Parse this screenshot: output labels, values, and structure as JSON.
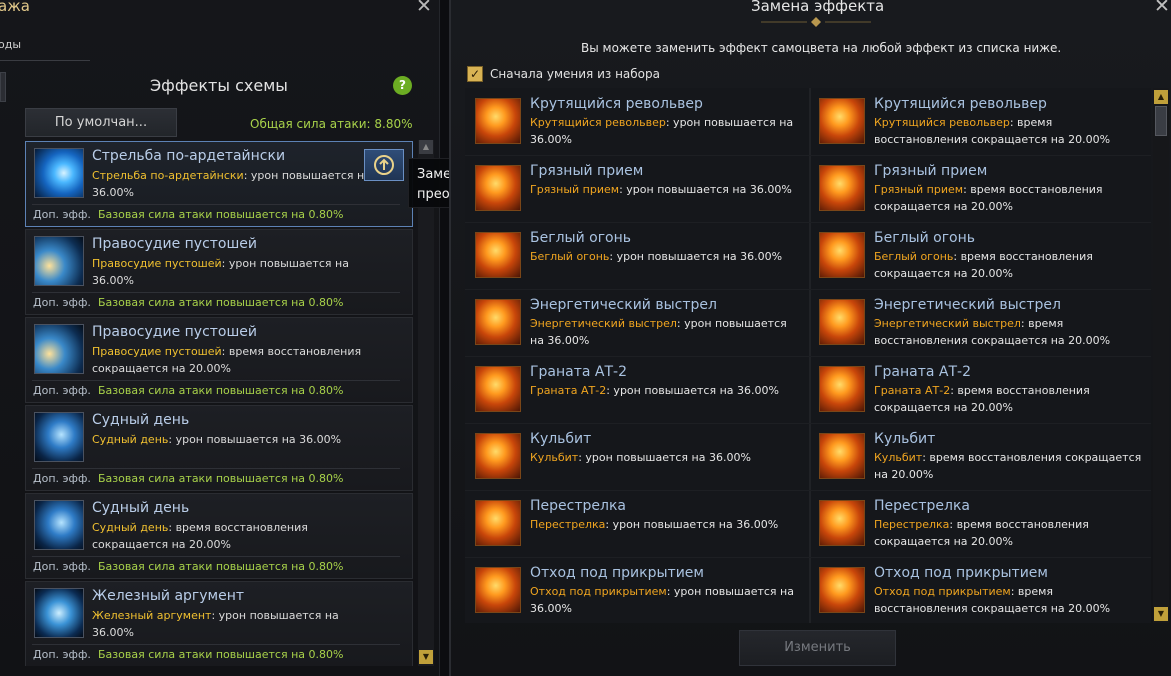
{
  "left_panel": {
    "title": "ажа",
    "tab": "оды",
    "scheme_title": "Эффекты схемы",
    "help_label": "?",
    "default_button": "По умолчан...",
    "total_attack": "Общая сила атаки: 8.80%",
    "effects": [
      {
        "name": "Стрельба по-ардетайнски",
        "skill": "Стрельба по-ардетайнски",
        "desc": ": урон повышается на 36.00%",
        "extra_label": "Доп. эфф.",
        "extra_value": "Базовая сила атаки повышается на 0.80%",
        "selected": true
      },
      {
        "name": "Правосудие пустошей",
        "skill": "Правосудие пустошей",
        "desc": ": урон повышается на 36.00%",
        "extra_label": "Доп. эфф.",
        "extra_value": "Базовая сила атаки повышается на 0.80%"
      },
      {
        "name": "Правосудие пустошей",
        "skill": "Правосудие пустошей",
        "desc": ": время восстановления сокращается на 20.00%",
        "extra_label": "Доп. эфф.",
        "extra_value": "Базовая сила атаки повышается на 0.80%"
      },
      {
        "name": "Судный день",
        "skill": "Судный день",
        "desc": ": урон повышается на 36.00%",
        "extra_label": "Доп. эфф.",
        "extra_value": "Базовая сила атаки повышается на 0.80%"
      },
      {
        "name": "Судный день",
        "skill": "Судный день",
        "desc": ": время восстановления сокращается на 20.00%",
        "extra_label": "Доп. эфф.",
        "extra_value": "Базовая сила атаки повышается на 0.80%"
      },
      {
        "name": "Железный аргумент",
        "skill": "Железный аргумент",
        "desc": ": урон повышается на 36.00%",
        "extra_label": "Доп. эфф.",
        "extra_value": "Базовая сила атаки повышается на 0.80%"
      }
    ]
  },
  "tooltip": "Замена эффекта преобразованного самоцвета",
  "right_panel": {
    "title": "Замена эффекта",
    "instruction": "Вы можете заменить эффект самоцвета на любой эффект из списка ниже.",
    "checkbox_label": "Сначала умения из набора",
    "checkbox_checked": true,
    "apply_button": "Изменить",
    "options": [
      {
        "name": "Крутящийся револьвер",
        "skill": "Крутящийся револьвер",
        "desc": ": урон повышается на 36.00%"
      },
      {
        "name": "Крутящийся револьвер",
        "skill": "Крутящийся револьвер",
        "desc": ": время восстановления сокращается на 20.00%"
      },
      {
        "name": "Грязный прием",
        "skill": "Грязный прием",
        "desc": ": урон повышается на 36.00%"
      },
      {
        "name": "Грязный прием",
        "skill": "Грязный прием",
        "desc": ": время восстановления сокращается на 20.00%"
      },
      {
        "name": "Беглый огонь",
        "skill": "Беглый огонь",
        "desc": ": урон повышается на 36.00%"
      },
      {
        "name": "Беглый огонь",
        "skill": "Беглый огонь",
        "desc": ": время восстановления сокращается на 20.00%"
      },
      {
        "name": "Энергетический выстрел",
        "skill": "Энергетический выстрел",
        "desc": ": урон повышается на 36.00%"
      },
      {
        "name": "Энергетический выстрел",
        "skill": "Энергетический выстрел",
        "desc": ": время восстановления сокращается на 20.00%"
      },
      {
        "name": "Граната АТ-2",
        "skill": "Граната АТ-2",
        "desc": ": урон повышается на 36.00%"
      },
      {
        "name": "Граната АТ-2",
        "skill": "Граната АТ-2",
        "desc": ": время восстановления сокращается на 20.00%"
      },
      {
        "name": "Кульбит",
        "skill": "Кульбит",
        "desc": ": урон повышается на 36.00%"
      },
      {
        "name": "Кульбит",
        "skill": "Кульбит",
        "desc": ": время восстановления сокращается на 20.00%"
      },
      {
        "name": "Перестрелка",
        "skill": "Перестрелка",
        "desc": ": урон повышается на 36.00%"
      },
      {
        "name": "Перестрелка",
        "skill": "Перестрелка",
        "desc": ": время восстановления сокращается на 20.00%"
      },
      {
        "name": "Отход под прикрытием",
        "skill": "Отход под прикрытием",
        "desc": ": урон повышается на 36.00%"
      },
      {
        "name": "Отход под прикрытием",
        "skill": "Отход под прикрытием",
        "desc": ": время восстановления сокращается на 20.00%"
      }
    ]
  },
  "colors": {
    "skill_name_left": "#f0c030",
    "skill_name_right": "#f0a520",
    "green": "#a8d24a",
    "title_blue": "#a9c2e0"
  }
}
